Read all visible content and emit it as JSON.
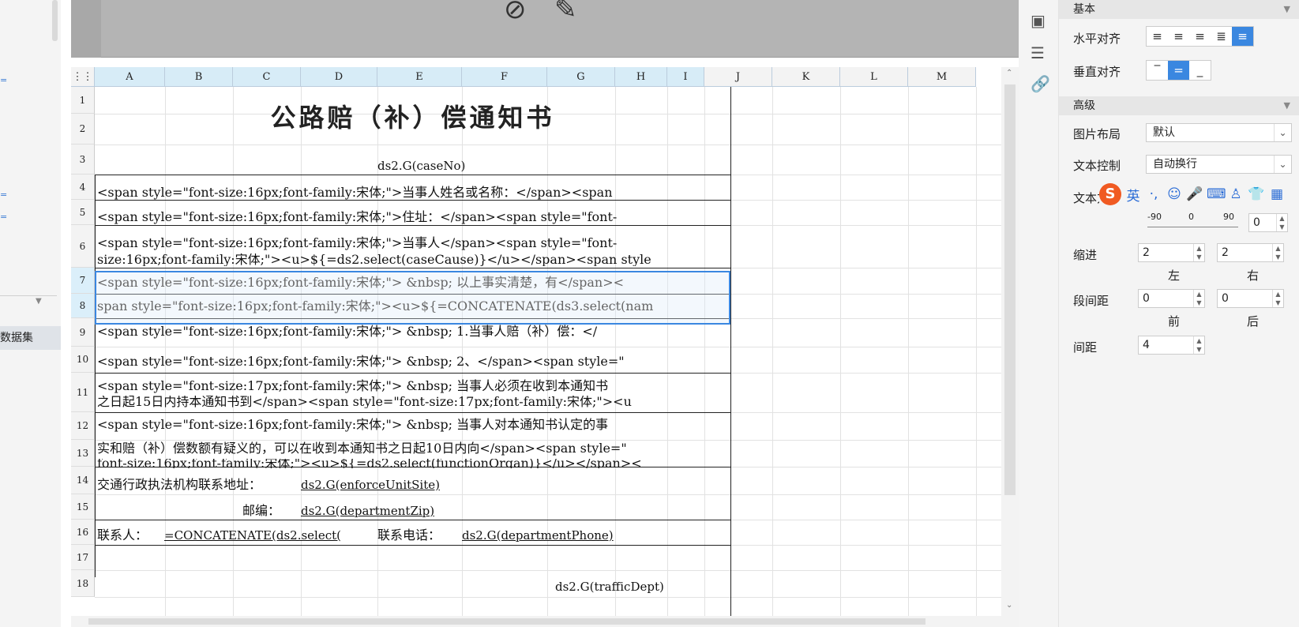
{
  "left_panel": {
    "dataset_label": "数据集"
  },
  "sheet": {
    "columns": [
      "A",
      "B",
      "C",
      "D",
      "E",
      "F",
      "G",
      "H",
      "I",
      "J",
      "K",
      "L",
      "M"
    ],
    "rows": [
      "1",
      "2",
      "3",
      "4",
      "5",
      "6",
      "7",
      "8",
      "9",
      "10",
      "11",
      "12",
      "13",
      "14",
      "15",
      "16",
      "17",
      "18"
    ],
    "title": "公路赔（补）偿通知书",
    "cells": {
      "r3": "ds2.G(caseNo)",
      "r4": "<span style=\"font-size:16px;font-family:宋体;\">当事人姓名或名称：</span><span",
      "r5": "<span style=\"font-size:16px;font-family:宋体;\">住址：</span><span style=\"font-",
      "r6a": "<span style=\"font-size:16px;font-family:宋体;\">当事人</span><span style=\"font-",
      "r6b": "size:16px;font-family:宋体;\"><u>${=ds2.select(caseCause)}</u></span><span style",
      "r7": "<span style=\"font-size:16px;font-family:宋体;\"> &nbsp; 以上事实清楚，有</span><",
      "r8": "span style=\"font-size:16px;font-family:宋体;\"><u>${=CONCATENATE(ds3.select(nam",
      "r9": "<span style=\"font-size:16px;font-family:宋体;\"> &nbsp; 1.当事人赔（补）偿：</",
      "r10": "<span style=\"font-size:16px;font-family:宋体;\"> &nbsp; 2、</span><span style=\"",
      "r11a": "<span style=\"font-size:17px;font-family:宋体;\"> &nbsp; 当事人必须在收到本通知书",
      "r11b": "之日起15日内持本通知书到</span><span style=\"font-size:17px;font-family:宋体;\"><u",
      "r12": "<span style=\"font-size:16px;font-family:宋体;\"> &nbsp; 当事人对本通知书认定的事",
      "r13a": "实和赔（补）偿数额有疑义的，可以在收到本通知书之日起10日内向</span><span style=\"",
      "r13b": "font-size:16px;font-family:宋体;\"><u>${=ds2.select(functionOrgan)}</u></span><",
      "r14_label": "交通行政执法机构联系地址：",
      "r14_value": "ds2.G(enforceUnitSite)",
      "r15_label": "邮编：",
      "r15_value": "ds2.G(departmentZip)",
      "r16_label": "联系人：",
      "r16_value": "=CONCATENATE(ds2.select(",
      "r16_phone_label": "联系电话：",
      "r16_phone_value": "ds2.G(departmentPhone)",
      "r18": "ds2.G(trafficDept)"
    }
  },
  "properties": {
    "section_basic": "基本",
    "h_align_label": "水平对齐",
    "v_align_label": "垂直对齐",
    "section_advanced": "高级",
    "image_layout_label": "图片布局",
    "image_layout_value": "默认",
    "text_control_label": "文本控制",
    "text_control_value": "自动换行",
    "text_dir_label": "文本方",
    "rotation_min": "-90",
    "rotation_mid": "0",
    "rotation_max": "90",
    "rotation_value": "0",
    "indent_label": "缩进",
    "indent_left": "2",
    "indent_right": "2",
    "left_label": "左",
    "right_label": "右",
    "para_spacing_label": "段间距",
    "para_before": "0",
    "para_after": "0",
    "before_label": "前",
    "after_label": "后",
    "spacing_label": "间距",
    "spacing_value": "4"
  },
  "ime_bar": {
    "lang": "英"
  }
}
